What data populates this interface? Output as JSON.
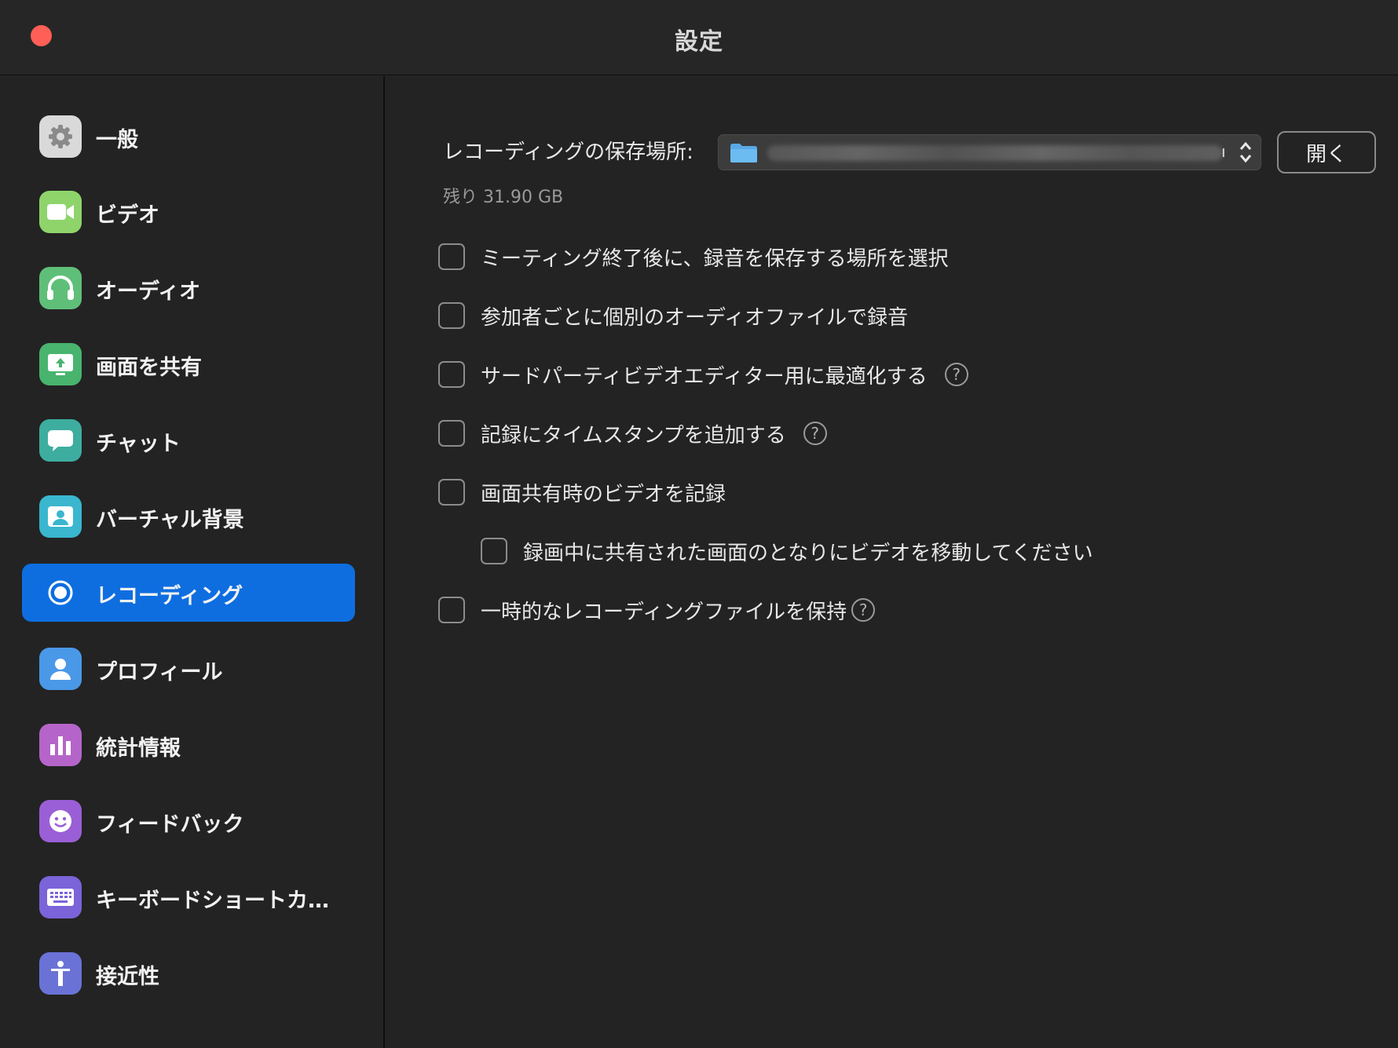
{
  "window": {
    "title": "設定"
  },
  "sidebar": {
    "items": [
      {
        "label": "一般",
        "color": "#d9d9d9"
      },
      {
        "label": "ビデオ",
        "color": "#8fd46b"
      },
      {
        "label": "オーディオ",
        "color": "#5fbf78"
      },
      {
        "label": "画面を共有",
        "color": "#48b46e"
      },
      {
        "label": "チャット",
        "color": "#3dada0"
      },
      {
        "label": "バーチャル背景",
        "color": "#3ab6cf"
      },
      {
        "label": "レコーディング",
        "color": "#0e6ee0"
      },
      {
        "label": "プロフィール",
        "color": "#4a98e8"
      },
      {
        "label": "統計情報",
        "color": "#b565c9"
      },
      {
        "label": "フィードバック",
        "color": "#9a5fd6"
      },
      {
        "label": "キーボードショートカ…",
        "color": "#7b63d9"
      },
      {
        "label": "接近性",
        "color": "#6a72d6"
      }
    ],
    "active_index": 6
  },
  "recording": {
    "location_label": "レコーディングの保存場所:",
    "path_tail": "ı",
    "open_button": "開く",
    "remaining": "残り 31.90 GB",
    "options": [
      {
        "label": "ミーティング終了後に、録音を保存する場所を選択",
        "checked": false,
        "help": false
      },
      {
        "label": "参加者ごとに個別のオーディオファイルで録音",
        "checked": false,
        "help": false
      },
      {
        "label": "サードパーティビデオエディター用に最適化する",
        "checked": false,
        "help": true
      },
      {
        "label": "記録にタイムスタンプを追加する",
        "checked": false,
        "help": true
      },
      {
        "label": "画面共有時のビデオを記録",
        "checked": false,
        "help": false
      },
      {
        "label": "録画中に共有された画面のとなりにビデオを移動してください",
        "checked": false,
        "help": false
      },
      {
        "label": "一時的なレコーディングファイルを保持",
        "checked": false,
        "help": true
      }
    ],
    "help_glyph": "?"
  }
}
